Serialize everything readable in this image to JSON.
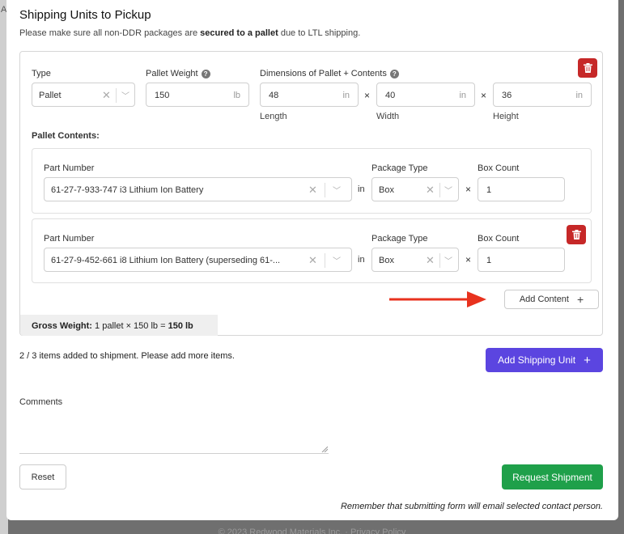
{
  "background": {
    "edge_char": "A",
    "footer_text": "© 2023 Redwood Materials Inc. · Privacy Policy"
  },
  "modal": {
    "title": "Shipping Units to Pickup",
    "subtitle_pre": "Please make sure all non-DDR packages are ",
    "subtitle_bold": "secured to a pallet",
    "subtitle_post": " due to LTL shipping."
  },
  "unit": {
    "type_label": "Type",
    "type_value": "Pallet",
    "weight_label": "Pallet Weight",
    "weight_value": "150",
    "weight_unit": "lb",
    "dims_label": "Dimensions of Pallet + Contents",
    "length_value": "48",
    "width_value": "40",
    "height_value": "36",
    "dim_unit": "in",
    "length_label": "Length",
    "width_label": "Width",
    "height_label": "Height",
    "times": "×",
    "contents_label": "Pallet Contents:",
    "contents": [
      {
        "part_label": "Part Number",
        "part_value": "61-27-7-933-747 i3 Lithium Ion Battery",
        "in_text": "in",
        "pkg_label": "Package Type",
        "pkg_value": "Box",
        "count_label": "Box Count",
        "count_value": "1"
      },
      {
        "part_label": "Part Number",
        "part_value": "61-27-9-452-661 i8 Lithium Ion Battery (superseding 61-...",
        "in_text": "in",
        "pkg_label": "Package Type",
        "pkg_value": "Box",
        "count_label": "Box Count",
        "count_value": "1"
      }
    ],
    "add_content_label": "Add Content",
    "plus": "+",
    "gross_prefix": "Gross Weight:",
    "gross_detail": "1 pallet  ×  150 lb  =",
    "gross_total": "150 lb"
  },
  "items_message": "2 / 3 items added to shipment. Please add more items.",
  "add_unit_label": "Add Shipping Unit",
  "comments_label": "Comments",
  "reset_label": "Reset",
  "request_label": "Request Shipment",
  "note": "Remember that submitting form will email selected contact person.",
  "colors": {
    "primary": "#5b45e0",
    "success": "#1fa04a",
    "danger": "#c62828",
    "arrow": "#e8321e"
  }
}
